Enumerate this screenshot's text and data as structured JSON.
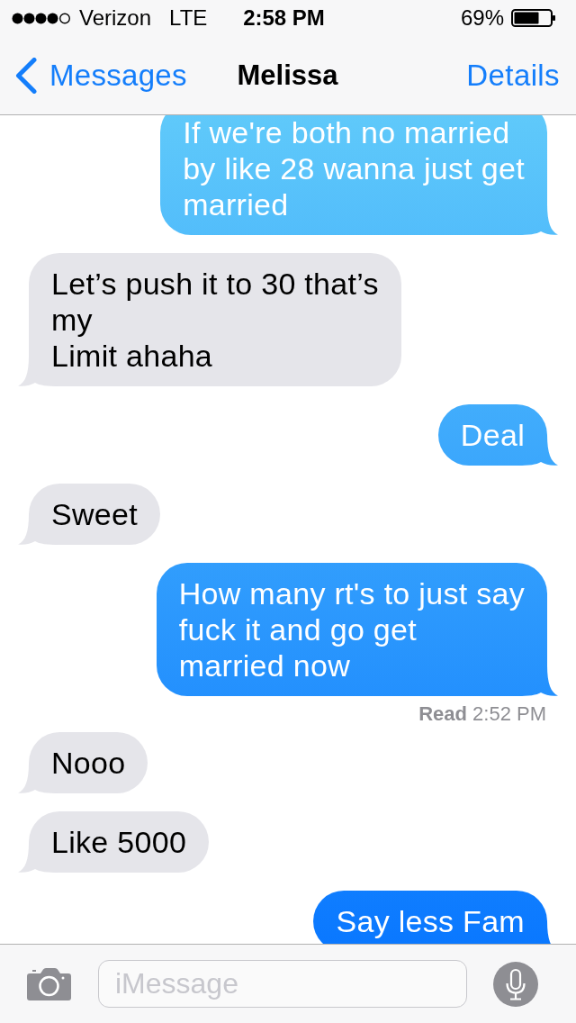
{
  "status_bar": {
    "carrier": "Verizon",
    "network": "LTE",
    "time": "2:58 PM",
    "battery": "69%"
  },
  "nav_bar": {
    "back": "Messages",
    "title": "Melissa",
    "action": "Details"
  },
  "messages": [
    {
      "kind": "sent",
      "text": "If we're both no married\nby like 28 wanna just get\nmarried"
    },
    {
      "kind": "received",
      "text": "Let’s push it to 30 that’s\nmy\nLimit ahaha"
    },
    {
      "kind": "sent",
      "text": "Deal"
    },
    {
      "kind": "received",
      "text": "Sweet"
    },
    {
      "kind": "sent",
      "text": "How many rt's to just say\nfuck it and go get\nmarried now",
      "read_receipt": "**Read** 2:52 PM"
    },
    {
      "kind": "received",
      "text": "Nooo"
    },
    {
      "kind": "received",
      "text": "Like 5000"
    },
    {
      "kind": "sent",
      "text": "Say less Fam"
    }
  ],
  "composer": {
    "placeholder": "iMessage"
  }
}
